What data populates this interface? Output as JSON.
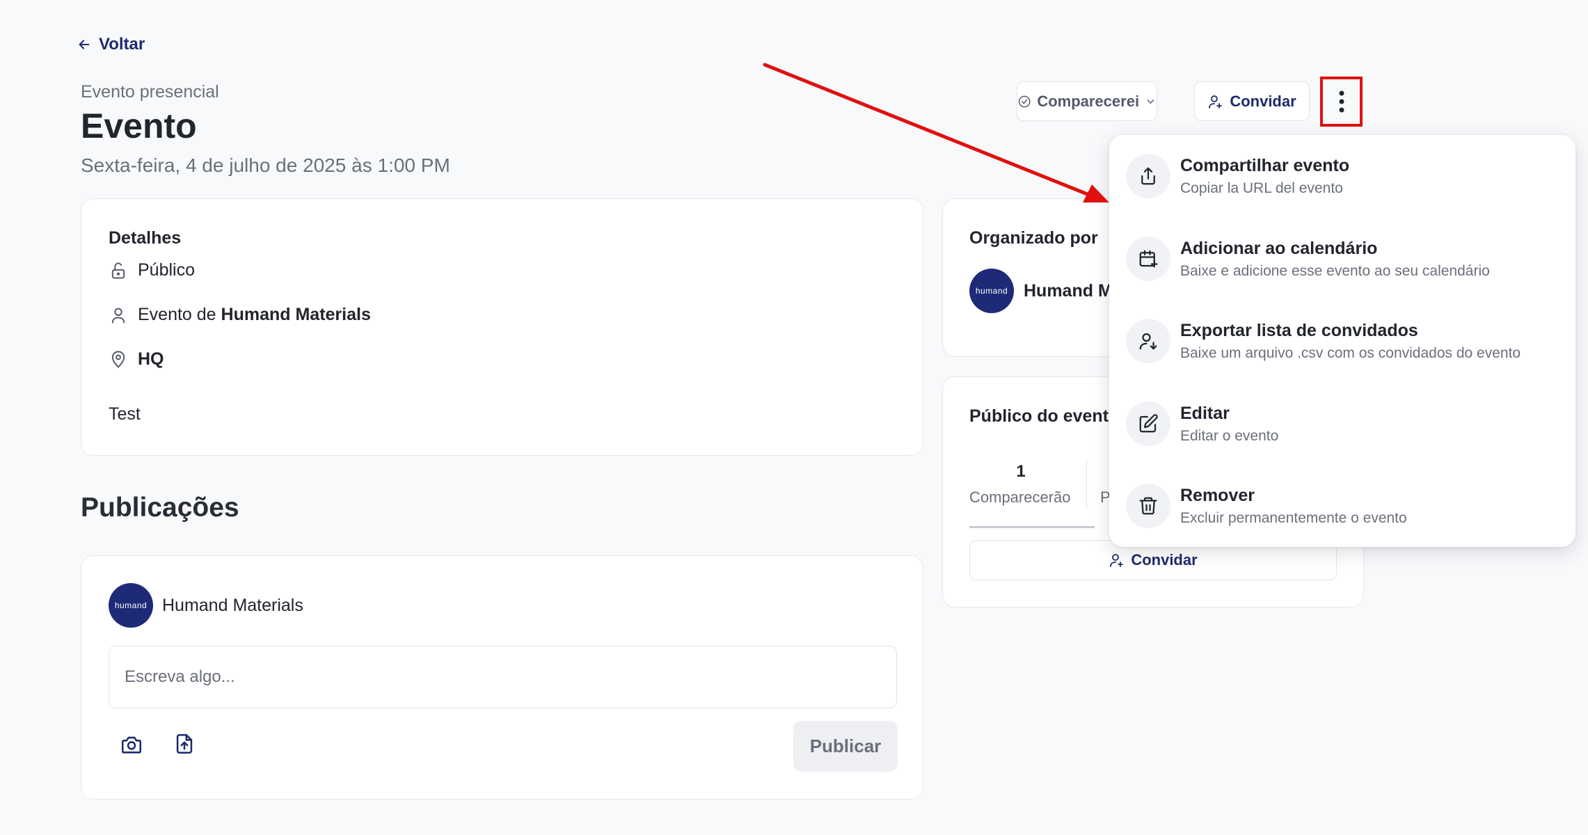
{
  "nav": {
    "back_label": "Voltar"
  },
  "event": {
    "type": "Evento presencial",
    "title": "Evento",
    "datetime": "Sexta-feira, 4 de julho de 2025 às 1:00 PM"
  },
  "actions": {
    "attend_label": "Comparecerei",
    "invite_label": "Convidar"
  },
  "details": {
    "heading": "Detalhes",
    "visibility": "Público",
    "organizer_prefix": "Evento de ",
    "organizer_name": "Humand Materials",
    "location": "HQ",
    "description": "Test"
  },
  "organizer_card": {
    "heading": "Organizado por",
    "name": "Humand M",
    "avatar_text": "humand"
  },
  "audience_card": {
    "heading": "Público do evento",
    "attending_count": "1",
    "attending_label": "Comparecerão",
    "second_label_partial": "P",
    "invite_label": "Convidar"
  },
  "publications": {
    "heading": "Publicações",
    "author": "Humand Materials",
    "avatar_text": "humand",
    "input_placeholder": "Escreva algo...",
    "publish_label": "Publicar"
  },
  "menu": {
    "items": [
      {
        "label": "Compartilhar evento",
        "desc": "Copiar la URL del evento",
        "icon": "share-icon"
      },
      {
        "label": "Adicionar ao calendário",
        "desc": "Baixe e adicione esse evento ao seu calendário",
        "icon": "calendar-plus-icon"
      },
      {
        "label": "Exportar lista de convidados",
        "desc": "Baixe um arquivo .csv com os convidados do evento",
        "icon": "user-download-icon"
      },
      {
        "label": "Editar",
        "desc": "Editar o evento",
        "icon": "edit-icon"
      },
      {
        "label": "Remover",
        "desc": "Excluir permanentemente o evento",
        "icon": "trash-icon"
      }
    ]
  },
  "colors": {
    "brand": "#1f2a6b",
    "avatar_bg": "#1e2a78",
    "annotation_red": "#e01010"
  }
}
